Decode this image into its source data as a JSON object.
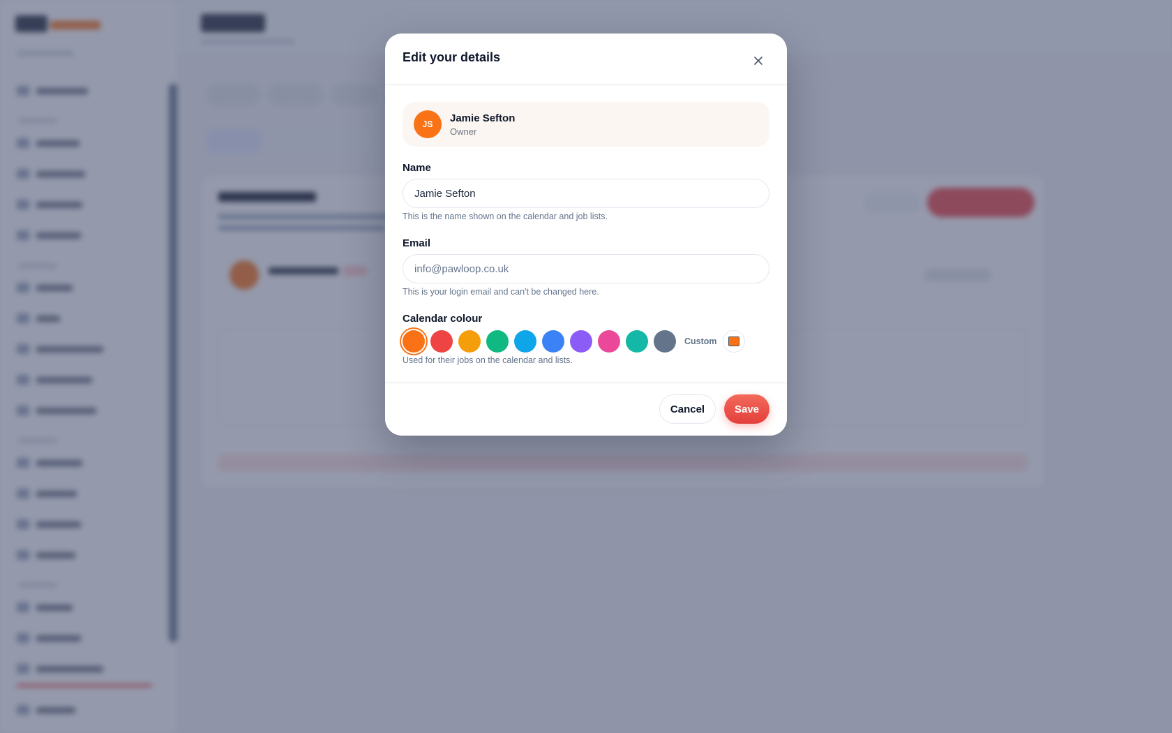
{
  "modal": {
    "title": "Edit your details",
    "close_icon": "close-icon",
    "user": {
      "initials": "JS",
      "name": "Jamie Sefton",
      "role": "Owner",
      "avatar_color": "#f97316"
    },
    "name_field": {
      "label": "Name",
      "value": "Jamie Sefton",
      "hint": "This is the name shown on the calendar and job lists."
    },
    "email_field": {
      "label": "Email",
      "value": "info@pawloop.co.uk",
      "hint": "This is your login email and can't be changed here."
    },
    "calendar_colour": {
      "label": "Calendar colour",
      "selected": "#f97316",
      "swatches": [
        "#f97316",
        "#ef4444",
        "#f59e0b",
        "#10b981",
        "#0ea5e9",
        "#3b82f6",
        "#8b5cf6",
        "#ec4899",
        "#14b8a6",
        "#64748b"
      ],
      "custom_label": "Custom",
      "custom_value": "#f97316",
      "hint": "Used for their jobs on the calendar and lists."
    },
    "footer": {
      "cancel_label": "Cancel",
      "save_label": "Save"
    }
  },
  "colors": {
    "accent": "#f97316",
    "primary_button": "#ef4444",
    "overlay": "#474f6e"
  }
}
